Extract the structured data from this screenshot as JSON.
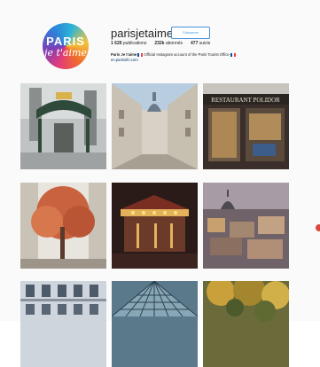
{
  "profile": {
    "username": "parisjetaime",
    "follow_label": "S'abonner",
    "avatar_text_top": "PARIS",
    "avatar_text_script": "je t'aime",
    "stats": [
      {
        "value": "1 626",
        "label": "publications"
      },
      {
        "value": "232k",
        "label": "abonnés"
      },
      {
        "value": "477",
        "label": "suivis"
      }
    ],
    "bio_name": "Paris Je t'aime",
    "bio_text": "Official Instagram account of the Paris Tourist Office",
    "bio_link": "en.parisinfo.com"
  },
  "posts": [
    {
      "name": "post-metro-entrance"
    },
    {
      "name": "post-sorbonne-street"
    },
    {
      "name": "post-restaurant-polidor"
    },
    {
      "name": "post-autumn-tree-courtyard"
    },
    {
      "name": "post-carousel-night"
    },
    {
      "name": "post-rooftops-view"
    },
    {
      "name": "post-haussmann-facade"
    },
    {
      "name": "post-glass-dome"
    },
    {
      "name": "post-autumn-leaves"
    }
  ],
  "colors": {
    "accent": "#3897f0",
    "text": "#262626"
  }
}
